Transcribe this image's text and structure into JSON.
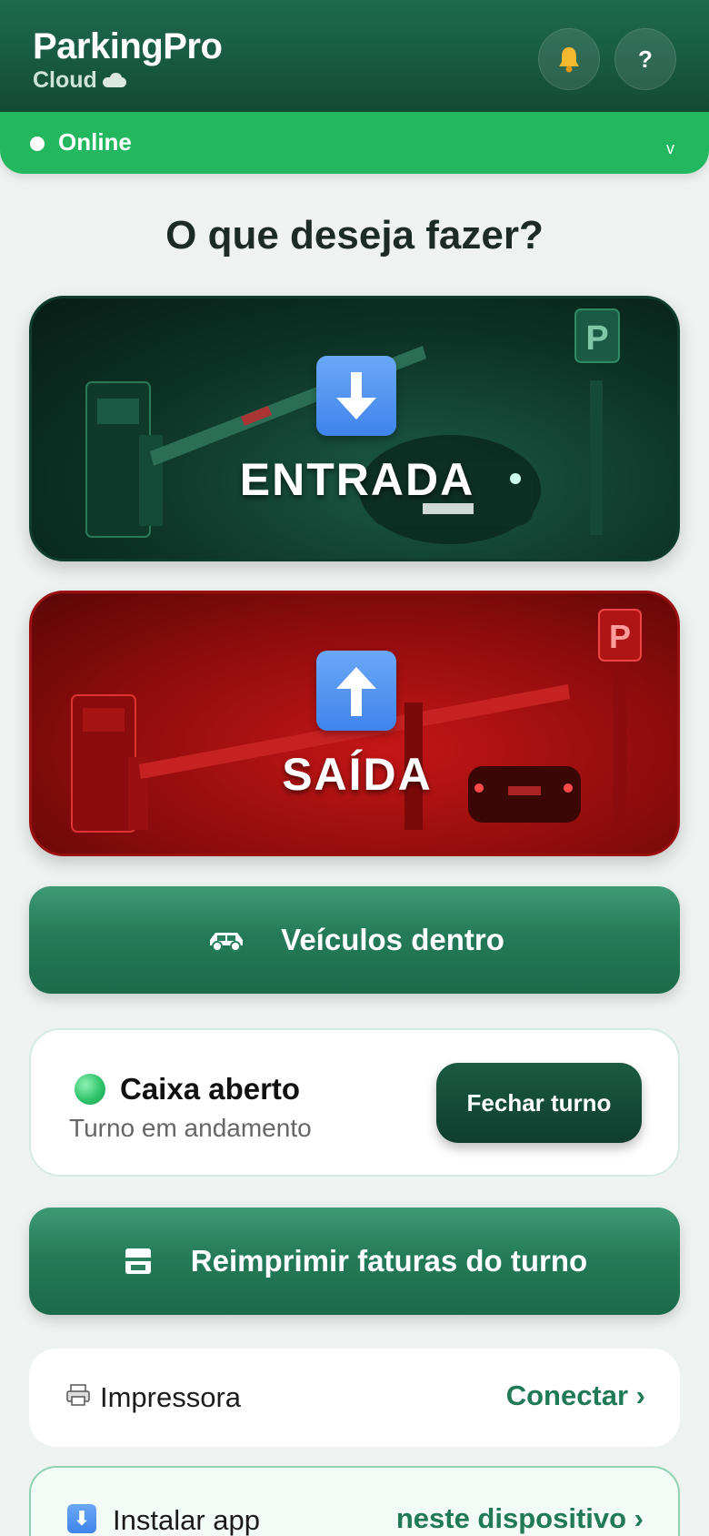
{
  "header": {
    "title": "ParkingPro",
    "subtitle": "Cloud",
    "icons": {
      "cloud": "cloud-icon",
      "bell": "bell-icon",
      "help": "question-mark-icon"
    },
    "help_label": "?"
  },
  "status": {
    "label": "Online",
    "chevron": "v"
  },
  "main": {
    "question": "O que deseja fazer?",
    "entrada": {
      "label": "ENTRADA",
      "icon": "arrow-down-icon"
    },
    "saida": {
      "label": "SAÍDA",
      "icon": "arrow-up-icon"
    },
    "vehicles_button": {
      "label": "Veículos dentro",
      "icon": "car-icon"
    },
    "cash": {
      "title": "Caixa aberto",
      "subtitle": "Turno em andamento",
      "close_button": "Fechar turno"
    },
    "reprint_button": {
      "label": "Reimprimir faturas do turno",
      "icon": "printer-icon"
    },
    "printer": {
      "label": "Impressora",
      "action": "Conectar ›",
      "icon": "printer-icon"
    },
    "install": {
      "label": "Instalar app",
      "action": "neste dispositivo ›",
      "icon": "download-icon",
      "icon_glyph": "⬇"
    }
  },
  "colors": {
    "header_bg": "#134a36",
    "status_green": "#23b85f",
    "entrada_bg": "#0d3326",
    "saida_bg": "#8f0c0c",
    "accent_green": "#1f7a55",
    "arrow_blue": "#3f84ec"
  }
}
